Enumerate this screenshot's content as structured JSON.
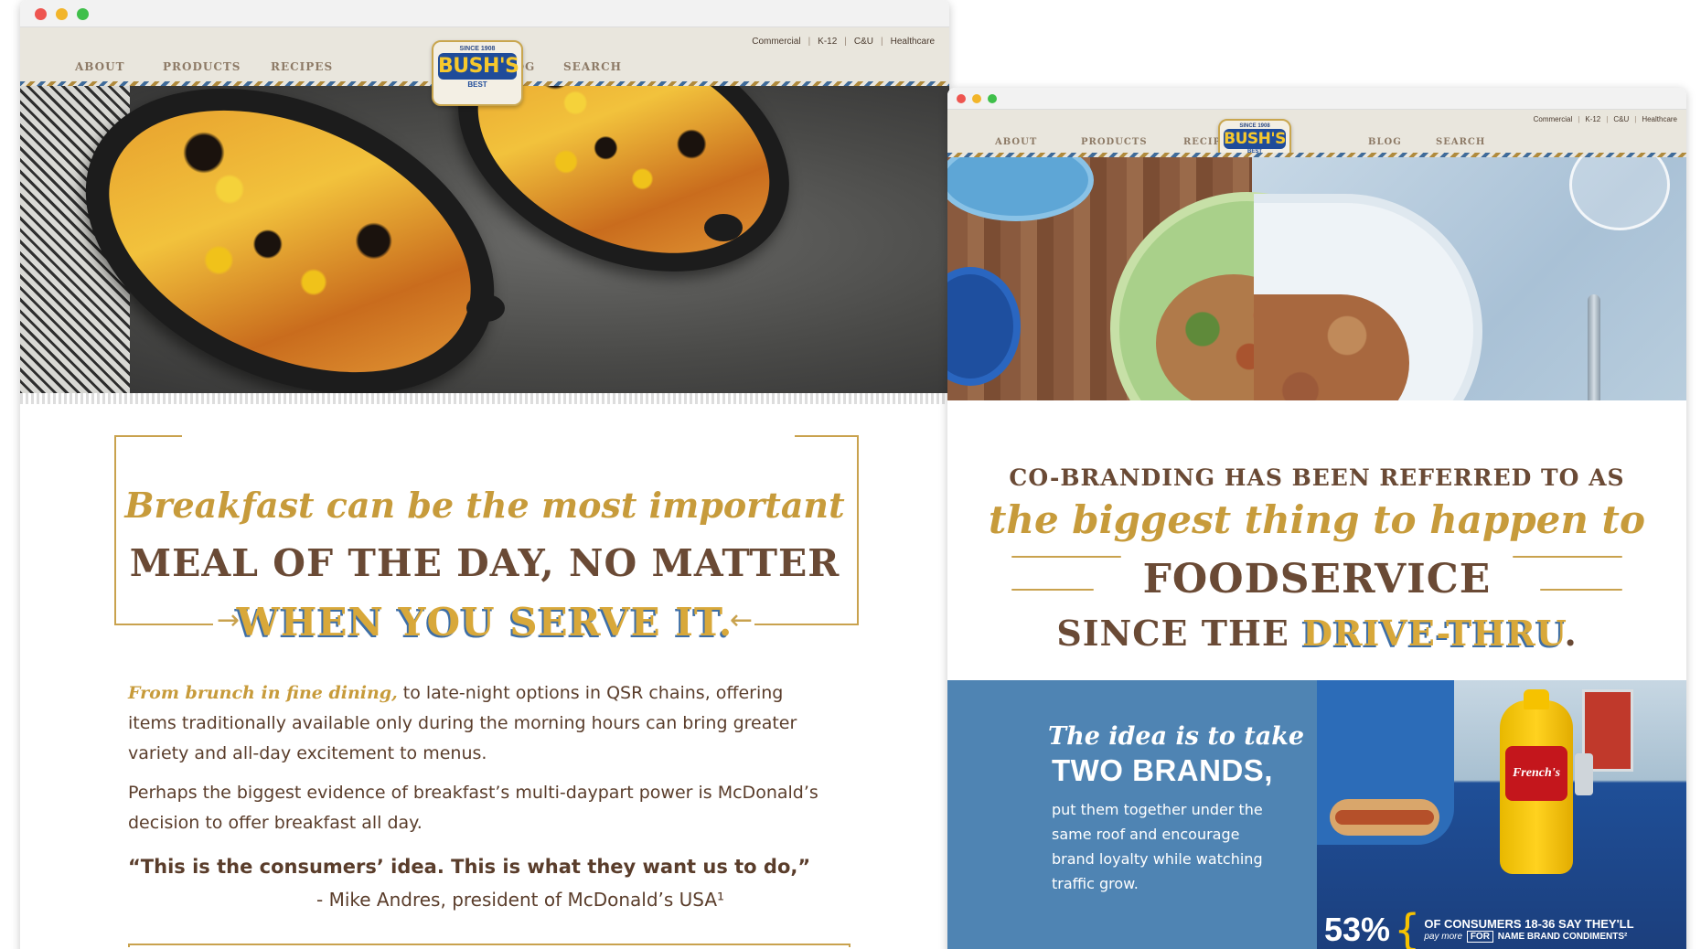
{
  "left_window": {
    "utility_links": [
      "Commercial",
      "K-12",
      "C&U",
      "Healthcare"
    ],
    "nav": {
      "about": "ABOUT",
      "products": "PRODUCTS",
      "recipes": "RECIPES",
      "blog": "BLOG",
      "search": "SEARCH"
    },
    "logo": {
      "since": "SINCE 1908",
      "brand": "BUSH'S",
      "best": "BEST"
    },
    "headline": {
      "script_line": "Breakfast can be the most important",
      "line2": "MEAL OF THE DAY, NO MATTER",
      "line3": "WHEN YOU SERVE IT."
    },
    "body": {
      "lead_script": "From brunch in fine dining,",
      "p1_rest": " to late-night options in QSR chains, offering items traditionally available only during the morning hours can bring greater variety and all-day excitement to menus.",
      "p2": "Perhaps the biggest evidence of breakfast’s multi-daypart power is McDonald’s decision to offer breakfast all day.",
      "quote": "“This is the consumers’ idea. This is what they want us to do,”",
      "attribution": "- Mike Andres, president of McDonald’s USA¹"
    }
  },
  "right_window": {
    "utility_links": [
      "Commercial",
      "K-12",
      "C&U",
      "Healthcare"
    ],
    "nav": {
      "about": "ABOUT",
      "products": "PRODUCTS",
      "recipes": "RECIPES",
      "blog": "BLOG",
      "search": "SEARCH"
    },
    "logo": {
      "since": "SINCE 1908",
      "brand": "BUSH'S",
      "best": "BEST"
    },
    "headline": {
      "line1": "CO-BRANDING HAS BEEN REFERRED TO AS",
      "script_line": "the biggest thing to happen to",
      "line3": "FOODSERVICE",
      "line4_prefix": "SINCE THE ",
      "line4_highlight": "DRIVE-THRU",
      "line4_suffix": "."
    },
    "band": {
      "script": "The idea is to take",
      "bold": "TWO BRANDS,",
      "text": "put them together under the same roof and encourage brand loyalty while watching traffic grow."
    },
    "ad": {
      "label": "French's",
      "stat_pct": "53%",
      "stat_line1": "OF CONSUMERS 18-36 SAY THEY'LL",
      "stat_line2_pre": "pay more",
      "stat_line2_for": "FOR",
      "stat_line2_post": "NAME BRAND CONDIMENTS²"
    }
  },
  "colors": {
    "brown": "#5a3d2b",
    "gold": "#c79b3b",
    "blue_band": "#4f84b3",
    "header_bg": "#e9e6dd"
  }
}
